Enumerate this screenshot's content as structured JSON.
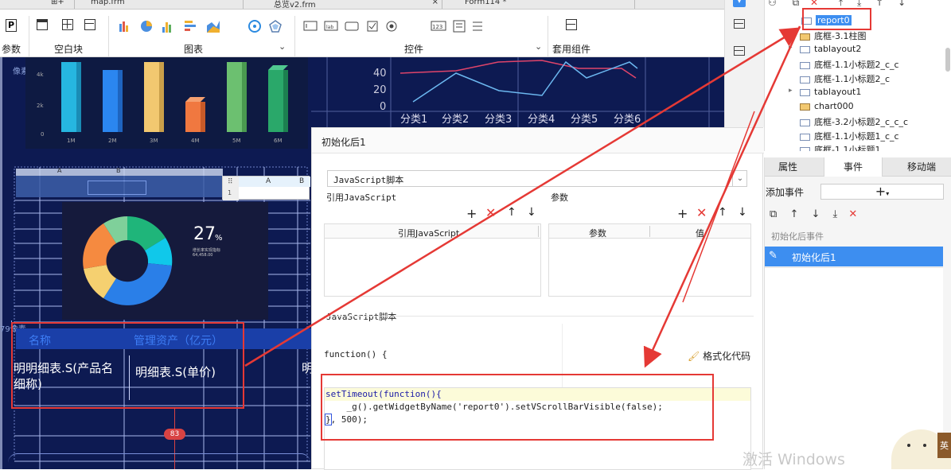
{
  "file_tabs": [
    "map.frm",
    "总览v2.frm",
    "Form114 *"
  ],
  "ribbon": {
    "groups": [
      "参数",
      "空白块",
      "图表",
      "控件",
      "套用组件"
    ],
    "param_letter": "P"
  },
  "canvas": {
    "y_ticks": [
      "4k",
      "2k",
      "0"
    ],
    "x_ticks": [
      "1M",
      "2M",
      "3M",
      "4M",
      "5M",
      "6M"
    ],
    "px_top": "像素",
    "px_mid": "79像素",
    "sheet_cols": [
      "A",
      "B"
    ],
    "sheet_row": "1",
    "sheet_cols2": [
      "A",
      "B"
    ],
    "donut_pct": "27",
    "donut_unit": "%",
    "donut_caption1": "增长率实现指标",
    "donut_caption2": "64,458.00",
    "header_name": "名称",
    "header_asset": "管理资产（亿元）",
    "cell_1": "明明细表.S(产品名",
    "cell_1b": "细称)",
    "cell_2": "明细表.S(单价)",
    "cell_3": "明",
    "badge": "83"
  },
  "chart2": {
    "y_ticks": [
      "40",
      "20",
      "0"
    ],
    "categories": [
      "分类1",
      "分类2",
      "分类3",
      "分类4",
      "分类5",
      "分类6"
    ]
  },
  "dialog": {
    "title": "初始化后1",
    "type_select": "JavaScript脚本",
    "ref_js_label": "引用JavaScript",
    "params_label": "参数",
    "ref_js_header": "引用JavaScript",
    "param_col": "参数",
    "value_col": "值",
    "js_script_label": "JavaScript脚本",
    "function_decl": "function() {",
    "format_code": "格式化代码",
    "code_line1": "setTimeout(function(){",
    "code_line2": "    _g().getWidgetByName('report0').setVScrollBarVisible(false);",
    "code_line3_tail": ", 500);",
    "code_line3_brace": "}"
  },
  "tree": {
    "items": [
      "report0",
      "底框-3.1柱图",
      "tablayout2",
      "底框-1.1小标题2_c_c",
      "底框-1.1小标题2_c",
      "tablayout1",
      "chart000",
      "底框-3.2小标题2_c_c_c",
      "底框-1.1小标题1_c_c",
      "底框-1.1小标题1"
    ]
  },
  "props": {
    "tabs": [
      "属性",
      "事件",
      "移动端"
    ],
    "add_event": "添加事件",
    "event_group": "初始化后事件",
    "event_item": "初始化后1"
  },
  "watermark": "激活 Windows",
  "ime": "英",
  "colors": {
    "accent_red": "#e53935",
    "selection_blue": "#3d8ef0",
    "canvas_navy": "#0d1a52"
  }
}
